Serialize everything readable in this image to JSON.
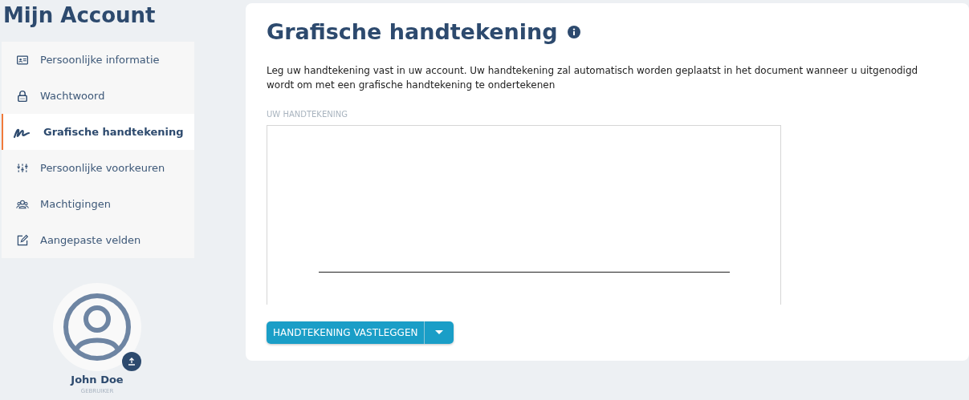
{
  "page_title": "Mijn Account",
  "nav": [
    {
      "label": "Persoonlijke informatie",
      "selected": false
    },
    {
      "label": "Wachtwoord",
      "selected": false
    },
    {
      "label": "Grafische handtekening",
      "selected": true
    },
    {
      "label": "Persoonlijke voorkeuren",
      "selected": false
    },
    {
      "label": "Machtigingen",
      "selected": false
    },
    {
      "label": "Aangepaste velden",
      "selected": false
    }
  ],
  "user": {
    "name": "John Doe",
    "role": "GEBRUIKER"
  },
  "card": {
    "title": "Grafische handtekening",
    "description": "Leg uw handtekening vast in uw account. Uw handtekening zal automatisch worden geplaatst in het document wanneer u uitgenodigd wordt om met een grafische handtekening te ondertekenen",
    "field_label": "UW HANDTEKENING",
    "button": "HANDTEKENING VASTLEGGEN"
  }
}
